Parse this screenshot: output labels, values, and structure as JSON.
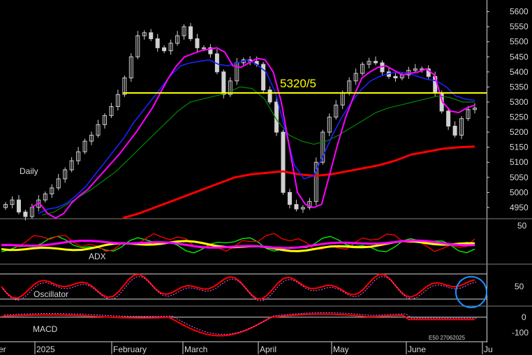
{
  "chart_data": {
    "type": "line",
    "instrument_note": "E50 27062025",
    "x_labels": [
      "er",
      "2025",
      "February",
      "March",
      "April",
      "May",
      "June",
      "Ju"
    ],
    "price_panel": {
      "label": "Daily",
      "y_ticks": [
        4950,
        5000,
        5050,
        5100,
        5150,
        5200,
        5250,
        5300,
        5350,
        5400,
        5450,
        5500,
        5550,
        5600
      ],
      "ylim": [
        4915,
        5620
      ],
      "level_line": {
        "value": 5330,
        "label": "5320/5",
        "color": "#ffff00"
      },
      "colors": {
        "candles": "#d0d0d0",
        "fast_ma": "#ff00ff",
        "mid_ma": "#2020ff",
        "slow_ma": "#008800",
        "long_ma": "#ff0000"
      },
      "close": [
        4960,
        4975,
        4935,
        4920,
        4950,
        4975,
        4995,
        5015,
        5045,
        5075,
        5105,
        5135,
        5170,
        5190,
        5225,
        5255,
        5285,
        5325,
        5380,
        5450,
        5520,
        5530,
        5510,
        5480,
        5470,
        5495,
        5520,
        5550,
        5510,
        5480,
        5480,
        5460,
        5400,
        5325,
        5370,
        5430,
        5440,
        5435,
        5425,
        5340,
        5300,
        5200,
        5000,
        4960,
        4945,
        4950,
        4970,
        5100,
        5200,
        5250,
        5290,
        5330,
        5370,
        5395,
        5425,
        5435,
        5430,
        5400,
        5385,
        5380,
        5390,
        5405,
        5410,
        5410,
        5385,
        5330,
        5270,
        5220,
        5190,
        5245,
        5275,
        5280
      ],
      "fast_ma": [
        4950,
        4965,
        4930,
        4915,
        4930,
        4965,
        4990,
        5010,
        5040,
        5070,
        5100,
        5130,
        5165,
        5200,
        5240,
        5280,
        5330,
        5380,
        5420,
        5450,
        5460,
        5470,
        5475,
        5480,
        5465,
        5420,
        5415,
        5430,
        5445,
        5440,
        5400,
        5300,
        5150,
        5000,
        4960,
        4950,
        4960,
        5060,
        5160,
        5250,
        5320,
        5380,
        5400,
        5415,
        5420,
        5405,
        5390,
        5395,
        5400,
        5410,
        5390,
        5300,
        5270,
        5265,
        5280,
        5290
      ],
      "mid_ma": [
        4930,
        4945,
        4950,
        4965,
        4990,
        5020,
        5060,
        5100,
        5140,
        5180,
        5230,
        5270,
        5310,
        5350,
        5390,
        5420,
        5430,
        5435,
        5440,
        5425,
        5420,
        5430,
        5440,
        5425,
        5400,
        5330,
        5210,
        5090,
        5045,
        5055,
        5120,
        5190,
        5250,
        5300,
        5340,
        5370,
        5385,
        5395,
        5400,
        5395,
        5385,
        5375,
        5370,
        5350,
        5320,
        5310,
        5305
      ],
      "slow_ma": [
        4925,
        4935,
        4960,
        4985,
        5010,
        5040,
        5070,
        5110,
        5150,
        5190,
        5230,
        5270,
        5300,
        5310,
        5320,
        5330,
        5350,
        5345,
        5310,
        5240,
        5190,
        5170,
        5160,
        5170,
        5190,
        5215,
        5240,
        5265,
        5280,
        5290,
        5300,
        5310,
        5320,
        5315,
        5300,
        5300
      ],
      "long_ma": [
        4915,
        4930,
        4950,
        4970,
        4990,
        5010,
        5030,
        5050,
        5060,
        5065,
        5070,
        5060,
        5055,
        5060,
        5070,
        5080,
        5090,
        5105,
        5125,
        5135,
        5145,
        5150,
        5152
      ]
    },
    "adx_panel": {
      "label": "ADX",
      "y_ticks": [
        50
      ],
      "colors": {
        "adx": "#ff00ff",
        "plus_di": "#00ff00",
        "minus_di": "#ff0000",
        "trend": "#ffff00"
      }
    },
    "oscillator_panel": {
      "label": "Oscillator",
      "y_ticks": [
        50
      ],
      "ylim": [
        0,
        100
      ],
      "levels": [
        20,
        80
      ],
      "highlight": "circle"
    },
    "macd_panel": {
      "label": "MACD",
      "y_ticks": [
        0,
        -100
      ],
      "ylim": [
        -140,
        40
      ]
    }
  }
}
